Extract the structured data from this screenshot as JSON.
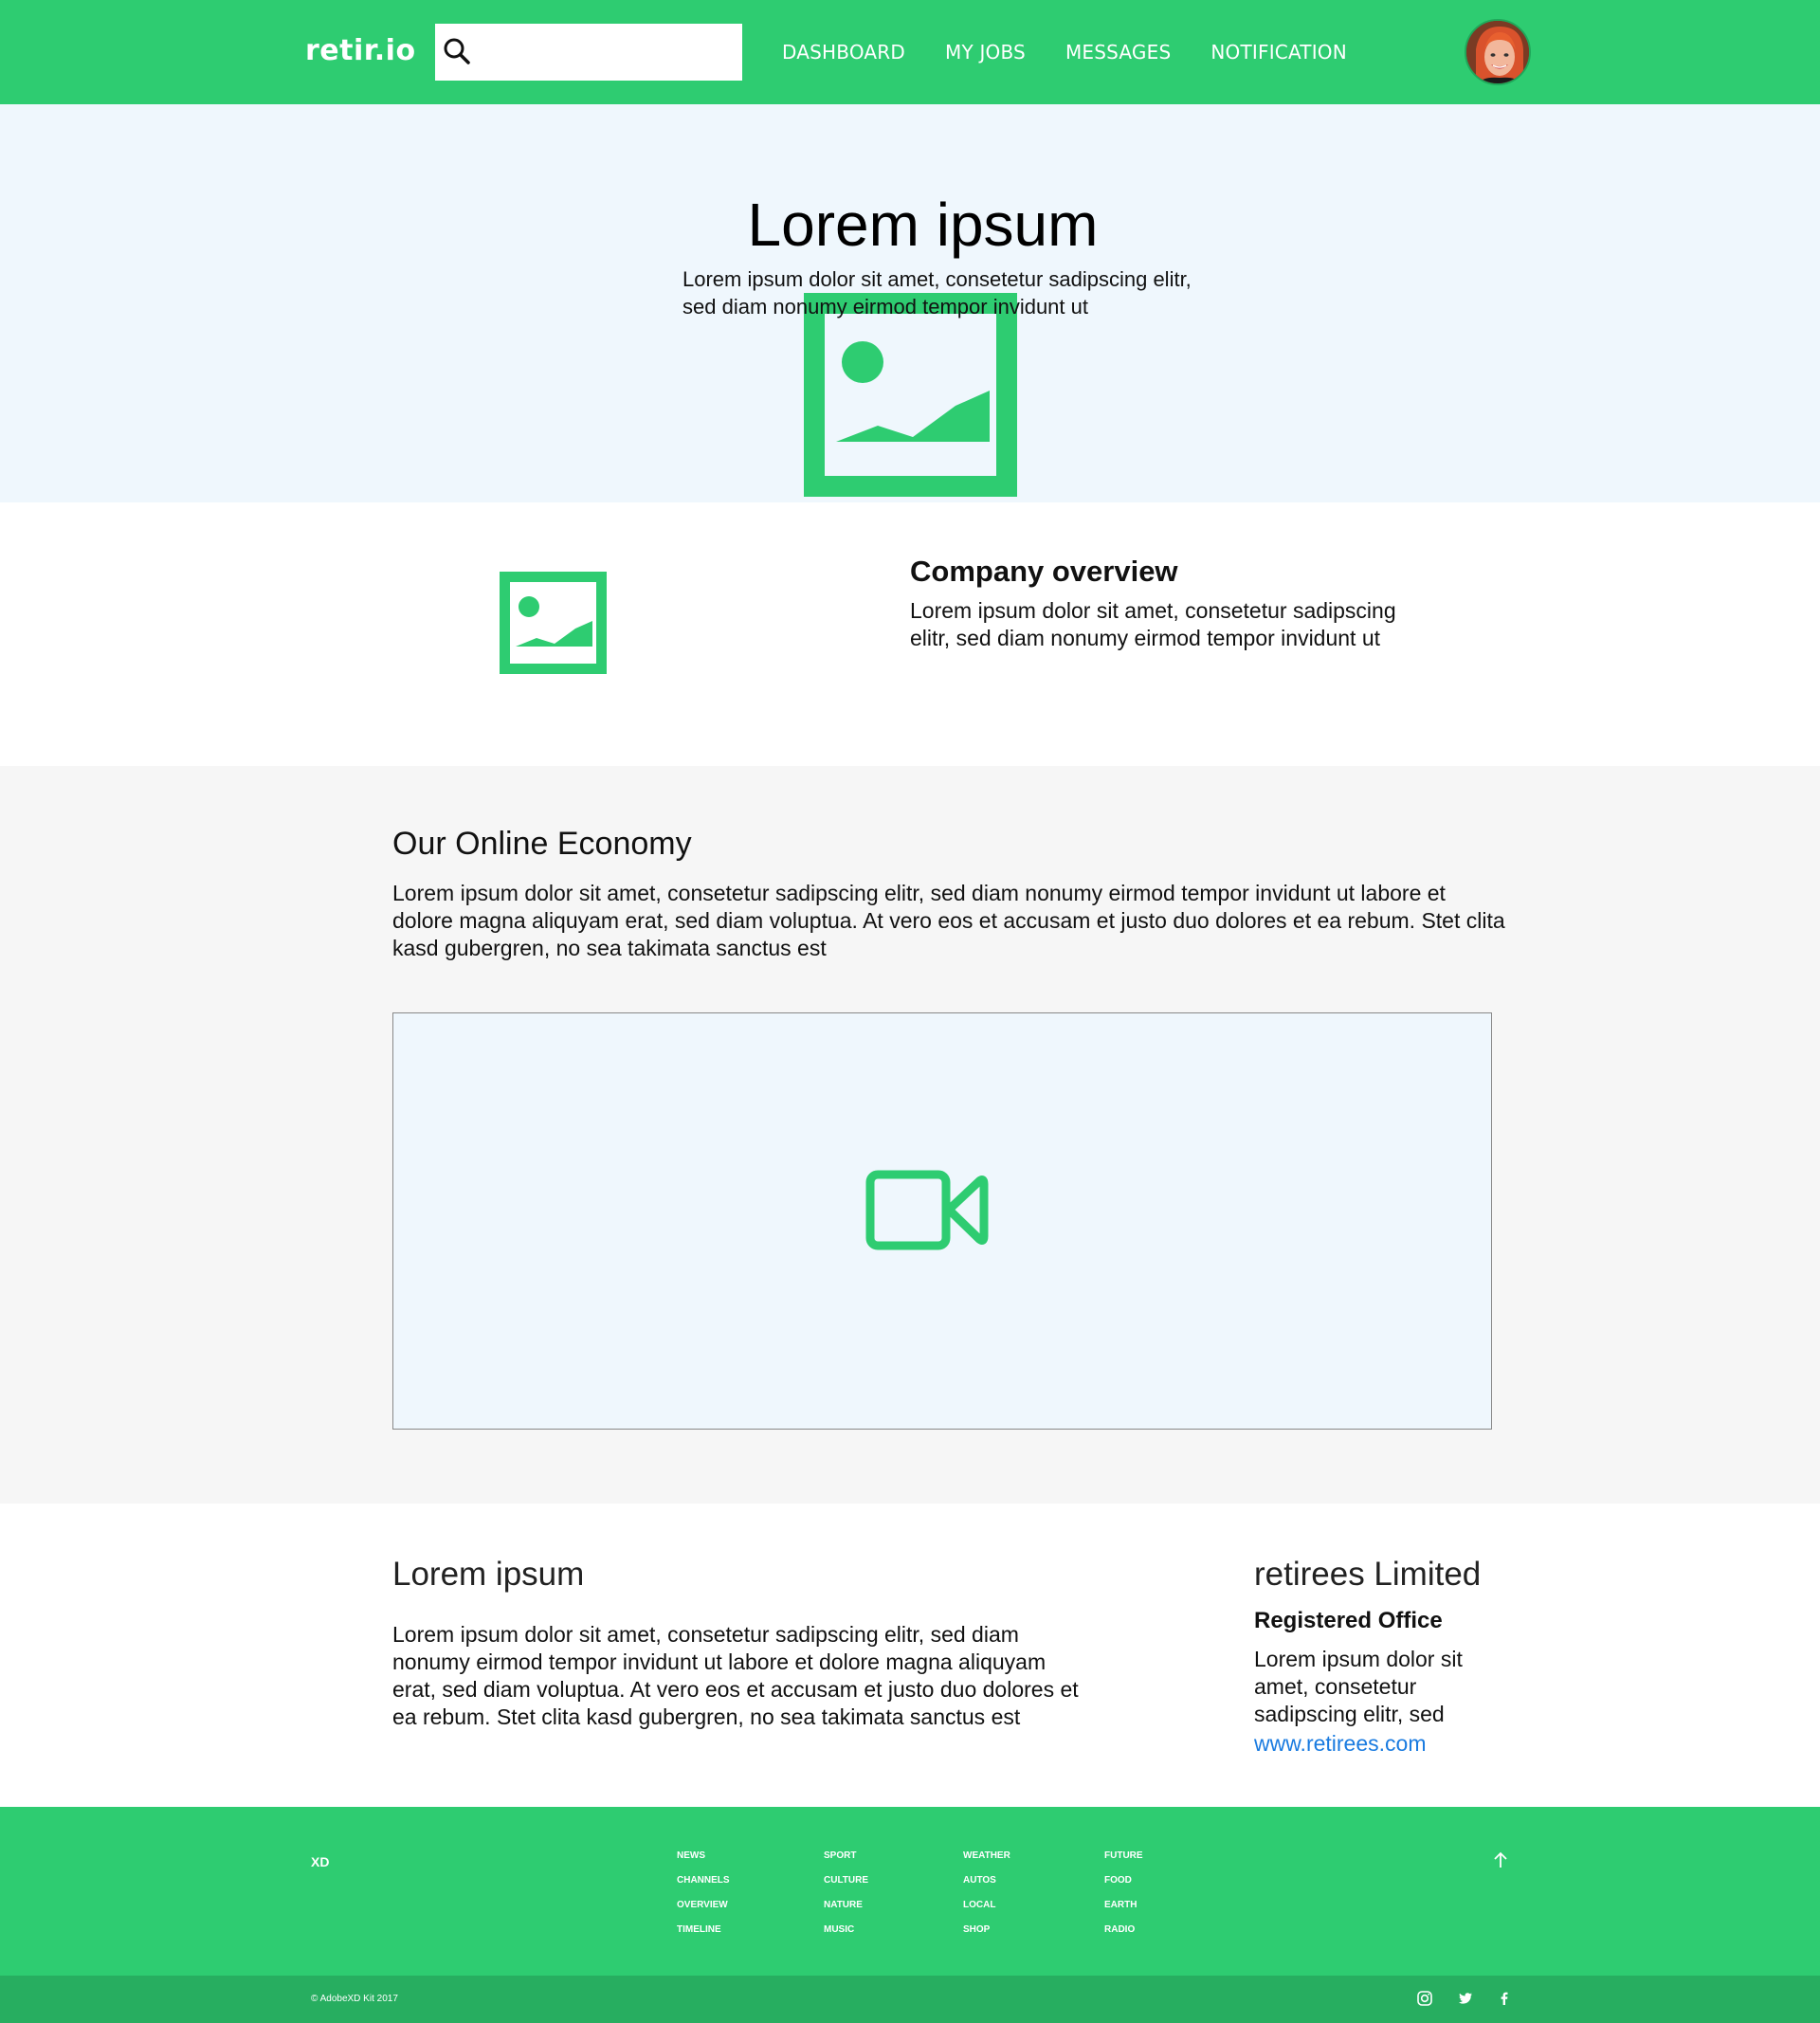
{
  "nav": {
    "logo": "retir.io",
    "search_placeholder": "",
    "links": [
      "DASHBOARD",
      "MY JOBS",
      "MESSAGES",
      "NOTIFICATION"
    ]
  },
  "hero": {
    "title": "Lorem ipsum",
    "subtitle": "Lorem ipsum dolor sit amet, consetetur sadipscing elitr, sed diam nonumy eirmod tempor invidunt ut"
  },
  "overview": {
    "title": "Company overview",
    "text": "Lorem ipsum dolor sit amet, consetetur sadipscing elitr, sed diam nonumy eirmod tempor invidunt ut"
  },
  "economy": {
    "title": "Our Online Economy",
    "text": "Lorem ipsum dolor sit amet, consetetur sadipscing elitr, sed diam nonumy eirmod tempor invidunt ut labore et dolore magna aliquyam erat, sed diam voluptua. At vero eos et accusam et justo duo dolores et ea rebum. Stet clita kasd gubergren, no sea takimata sanctus est"
  },
  "info": {
    "title": "Lorem ipsum",
    "text": "Lorem ipsum dolor sit amet, consetetur sadipscing elitr, sed diam nonumy eirmod tempor invidunt ut labore et dolore magna aliquyam erat, sed diam voluptua. At vero eos et accusam et justo duo dolores et ea rebum. Stet clita kasd gubergren, no sea takimata sanctus est"
  },
  "company": {
    "name": "retirees Limited",
    "office_label": "Registered Office",
    "address": "Lorem ipsum dolor sit amet, consetetur sadipscing elitr, sed",
    "website": "www.retirees.com"
  },
  "footer": {
    "brand": "XD",
    "col1": [
      "NEWS",
      "CHANNELS",
      "OVERVIEW",
      "TIMELINE"
    ],
    "col2": [
      "SPORT",
      "CULTURE",
      "NATURE",
      "MUSIC"
    ],
    "col3": [
      "WEATHER",
      "AUTOS",
      "LOCAL",
      "SHOP"
    ],
    "col4": [
      "FUTURE",
      "FOOD",
      "EARTH",
      "RADIO"
    ],
    "copyright": "© AdobeXD Kit 2017"
  },
  "colors": {
    "brand_green": "#2ecc71",
    "footer_dark_green": "#27ae60",
    "hero_bg": "#eff7fd",
    "link_blue": "#1a7be0"
  },
  "icons": [
    "search-icon",
    "image-placeholder-icon",
    "video-camera-icon",
    "arrow-up-icon",
    "instagram-icon",
    "twitter-icon",
    "facebook-icon"
  ]
}
